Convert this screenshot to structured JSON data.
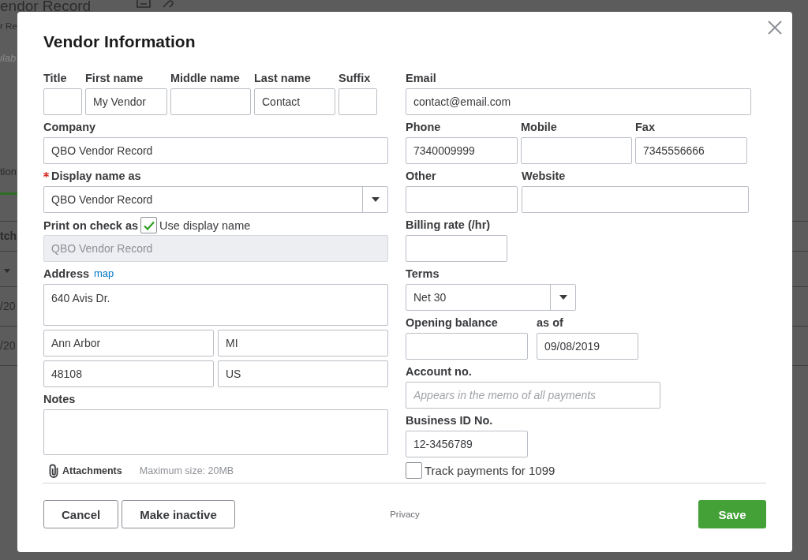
{
  "background_page": {
    "title": "endor Record",
    "subtitle": "r Re",
    "note": "ilab",
    "tab": {
      "label": "tion",
      "selected": true
    },
    "column_header": "tch",
    "rows": [
      {
        "cell": "/20"
      },
      {
        "cell": "/20"
      }
    ]
  },
  "dialog": {
    "title": "Vendor Information"
  },
  "name_fields": [
    {
      "label": "Title"
    },
    {
      "label": "First name",
      "value": "My Vendor"
    },
    {
      "label": "Middle name"
    },
    {
      "label": "Last name",
      "value": "Contact"
    },
    {
      "label": "Suffix"
    }
  ],
  "company": {
    "label": "Company",
    "value": "QBO Vendor Record"
  },
  "display_name": {
    "label": "Display name as",
    "required": true,
    "value": "QBO Vendor Record"
  },
  "print_on_check": {
    "label": "Print on check as",
    "checkbox": {
      "label": "Use display name",
      "checked": true
    },
    "value": "QBO Vendor Record",
    "disabled": true
  },
  "address": {
    "label": "Address",
    "link": "map",
    "street": "640 Avis Dr.",
    "city": "Ann Arbor",
    "state": "MI",
    "zip": "48108",
    "country": "US"
  },
  "notes": {
    "label": "Notes"
  },
  "attachments": {
    "label": "Attachments",
    "hint": "Maximum size: 20MB"
  },
  "email": {
    "label": "Email",
    "value": "contact@email.com"
  },
  "phones": [
    {
      "label": "Phone",
      "value": "7340009999"
    },
    {
      "label": "Mobile"
    },
    {
      "label": "Fax",
      "value": "7345556666"
    }
  ],
  "other_contacts": [
    {
      "label": "Other"
    },
    {
      "label": "Website"
    }
  ],
  "billing_rate": {
    "label": "Billing rate (/hr)"
  },
  "terms": {
    "label": "Terms",
    "value": "Net 30"
  },
  "opening_balance": {
    "label": "Opening balance"
  },
  "as_of": {
    "label": "as of",
    "value": "09/08/2019"
  },
  "account_no": {
    "label": "Account no.",
    "placeholder": "Appears in the memo of all payments"
  },
  "business_id": {
    "label": "Business ID No.",
    "value": "12-3456789"
  },
  "track_1099": {
    "label": "Track payments for 1099",
    "checked": false
  },
  "footer": {
    "buttons": [
      {
        "label": "Cancel",
        "kind": "secondary"
      },
      {
        "label": "Make inactive",
        "kind": "secondary"
      },
      {
        "label": "Save",
        "kind": "primary"
      }
    ],
    "privacy": "Privacy"
  }
}
